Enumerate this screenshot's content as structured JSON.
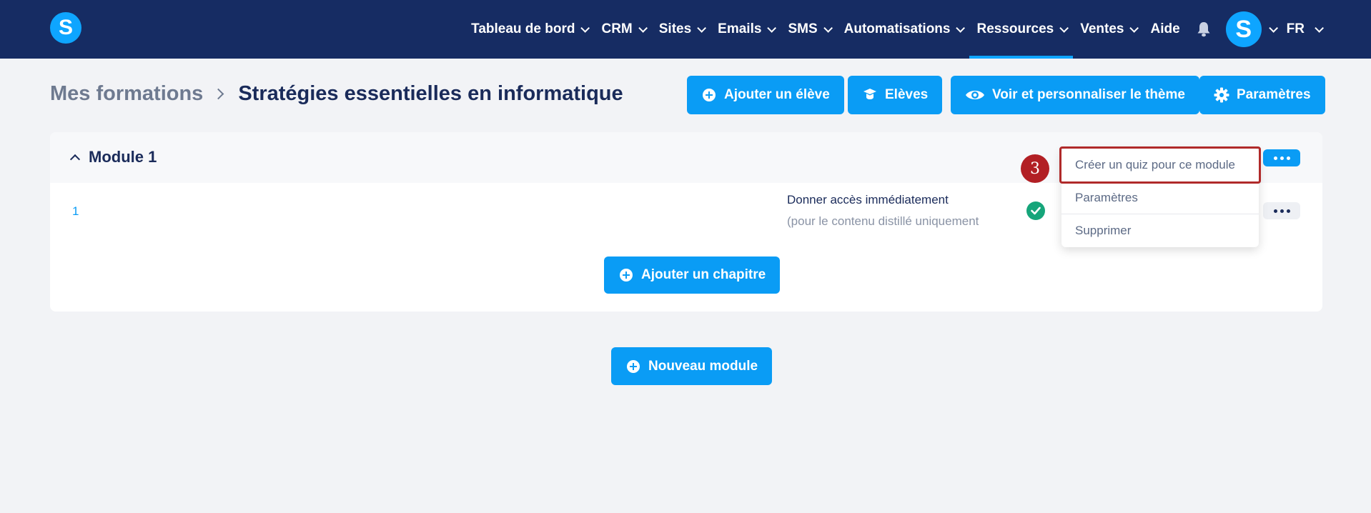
{
  "nav": {
    "items": [
      {
        "label": "Tableau de bord",
        "dropdown": true
      },
      {
        "label": "CRM",
        "dropdown": true
      },
      {
        "label": "Sites",
        "dropdown": true
      },
      {
        "label": "Emails",
        "dropdown": true
      },
      {
        "label": "SMS",
        "dropdown": true
      },
      {
        "label": "Automatisations",
        "dropdown": true
      },
      {
        "label": "Ressources",
        "dropdown": true,
        "active": true
      },
      {
        "label": "Ventes",
        "dropdown": true
      },
      {
        "label": "Aide",
        "dropdown": false
      }
    ],
    "avatar_letter": "S",
    "language": "FR"
  },
  "logo_letter": "S",
  "breadcrumb": {
    "parent": "Mes formations",
    "current": "Stratégies essentielles en informatique"
  },
  "actions": {
    "add_student": "Ajouter un élève",
    "students": "Elèves",
    "theme": "Voir et personnaliser le thème",
    "settings": "Paramètres"
  },
  "module": {
    "title": "Module 1",
    "chapter_number": "1",
    "access_title": "Donner accès immédiatement",
    "access_sub": "(pour le contenu distillé uniquement",
    "add_chapter": "Ajouter un chapitre"
  },
  "menu": {
    "items": [
      "Créer un quiz pour ce module",
      "Paramètres",
      "Supprimer"
    ]
  },
  "step_badge": "3",
  "new_module": "Nouveau module",
  "colors": {
    "nav_bg": "#162c63",
    "accent": "#0a9cf5",
    "highlight": "#b02a2a",
    "success": "#16a57a"
  }
}
